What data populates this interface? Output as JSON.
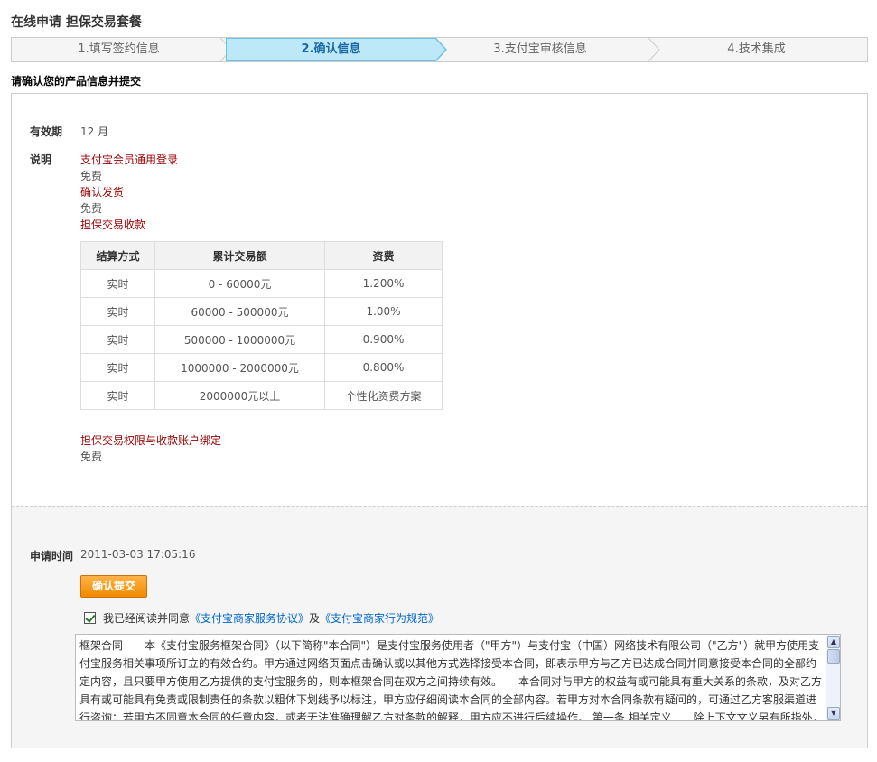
{
  "page_title": "在线申请 担保交易套餐",
  "steps": [
    {
      "label": "1.填写签约信息"
    },
    {
      "label": "2.确认信息"
    },
    {
      "label": "3.支付宝审核信息"
    },
    {
      "label": "4.技术集成"
    }
  ],
  "subhead": "请确认您的产品信息并提交",
  "validity": {
    "label": "有效期",
    "value": "12 月"
  },
  "description": {
    "label": "说明",
    "items": [
      {
        "name": "支付宝会员通用登录",
        "fee": "免费"
      },
      {
        "name": "确认发货",
        "fee": "免费"
      },
      {
        "name": "担保交易收款"
      }
    ]
  },
  "rate_table": {
    "headers": [
      "结算方式",
      "累计交易额",
      "资费"
    ],
    "rows": [
      [
        "实时",
        "0 - 60000元",
        "1.200%"
      ],
      [
        "实时",
        "60000 - 500000元",
        "1.00%"
      ],
      [
        "实时",
        "500000 - 1000000元",
        "0.900%"
      ],
      [
        "实时",
        "1000000 - 2000000元",
        "0.800%"
      ],
      [
        "实时",
        "2000000元以上",
        "个性化资费方案"
      ]
    ]
  },
  "binding": {
    "name": "担保交易权限与收款账户绑定",
    "fee": "免费"
  },
  "apply_time": {
    "label": "申请时间",
    "value": "2011-03-03 17:05:16"
  },
  "submit_button": "确认提交",
  "agreement": {
    "checked": true,
    "prefix": "我已经阅读并同意",
    "link1": "《支付宝商家服务协议》",
    "middle": "及",
    "link2": "《支付宝商家行为规范》"
  },
  "contract_text": "框架合同　　本《支付宝服务框架合同》（以下简称\"本合同\"）是支付宝服务使用者（\"甲方\"）与支付宝（中国）网络技术有限公司（\"乙方\"）就甲方使用支付宝服务相关事项所订立的有效合约。甲方通过网络页面点击确认或以其他方式选择接受本合同，即表示甲方与乙方已达成合同并同意接受本合同的全部约定内容，且只要甲方使用乙方提供的支付宝服务的，则本框架合同在双方之间持续有效。　　本合同对与甲方的权益有或可能具有重大关系的条款，及对乙方具有或可能具有免责或限制责任的条款以粗体下划线予以标注，甲方应仔细阅读本合同的全部内容。若甲方对本合同条款有疑问的，可通过乙方客服渠道进行咨询；若甲方不同意本合同的任意内容，或者无法准确理解乙方对条款的解释，甲方应不进行后续操作。 第一条 相关定义　　除上下文文义另有所指外，本合同下列词语具有以下含义："
}
